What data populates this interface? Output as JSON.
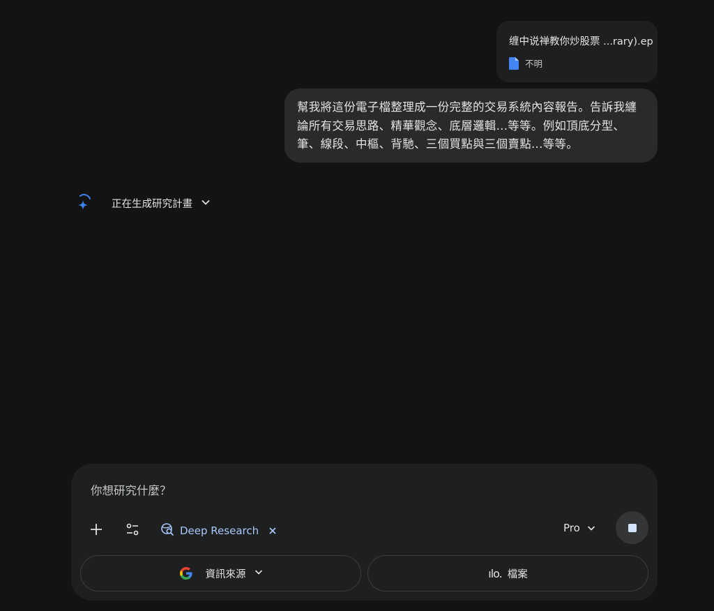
{
  "attachment": {
    "file_name": "缠中说禅教你炒股票 ...rary).ep",
    "file_type": "不明",
    "icon": "document-icon"
  },
  "user_message": {
    "text": "幫我將這份電子檔整理成一份完整的交易系統內容報告。告訴我纏論所有交易思路、精華觀念、底層邏輯...等等。例如頂底分型、筆、線段、中樞、背馳、三個買點與三個賣點...等等。"
  },
  "status": {
    "label": "正在生成研究計畫",
    "icon": "gemini-spark-icon"
  },
  "composer": {
    "placeholder": "你想研究什麼？",
    "value": "",
    "deep_research_label": "Deep Research",
    "model_label": "Pro",
    "sources_label": "資訊來源",
    "files_label": "檔案",
    "files_glyph": "ılo."
  },
  "colors": {
    "background": "#131314",
    "bubble": "#282a2c",
    "accent": "#a8c7fa",
    "spark": "#4285f4"
  }
}
